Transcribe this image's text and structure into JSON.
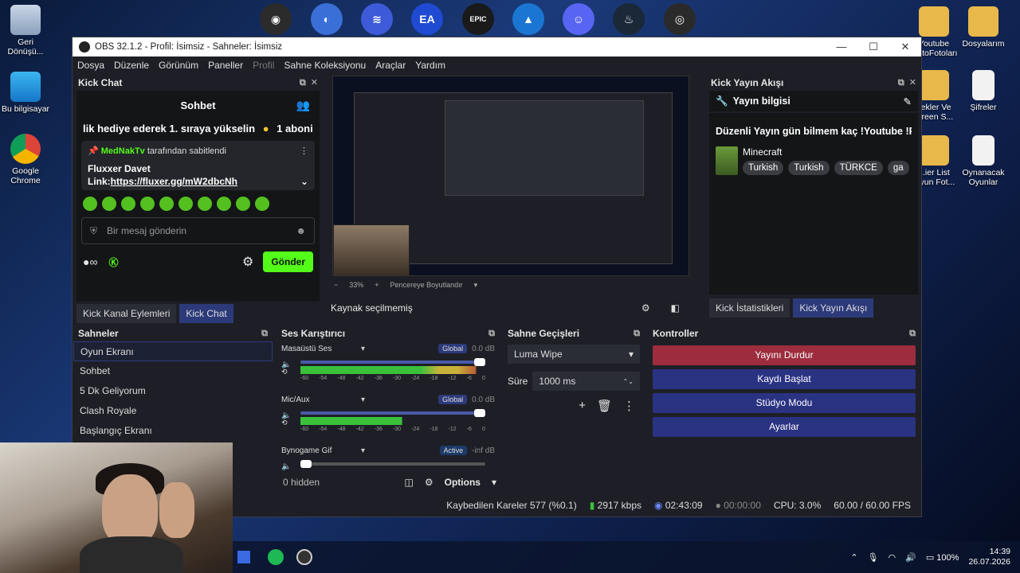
{
  "desktop": {
    "left_icons": [
      {
        "label": "Geri Dönüşü..."
      },
      {
        "label": "Bu bilgisayar"
      },
      {
        "label": "Google Chrome"
      }
    ],
    "right_icons": [
      {
        "label": "Youtube ...otoFotoları"
      },
      {
        "label": "Dosyalarım"
      },
      {
        "label": "Şifreler"
      },
      {
        "label": "Tekler Ve ...reen S..."
      },
      {
        "label": "...ier List ...yun Fot..."
      },
      {
        "label": "Oynanacak Oyunlar"
      }
    ],
    "top_icons": [
      {
        "name": "obs",
        "color": "#2b2b2b",
        "glyph": "◉"
      },
      {
        "name": "browser",
        "color": "#3b6fd8",
        "glyph": "◐"
      },
      {
        "name": "app-wave",
        "color": "#3d5bd9",
        "glyph": "≋"
      },
      {
        "name": "ea",
        "color": "#1f4ad1",
        "glyph": "EA"
      },
      {
        "name": "epic-games",
        "color": "#1a1a1a",
        "glyph": "EPIC"
      },
      {
        "name": "app-mountain",
        "color": "#1a76d2",
        "glyph": "▲"
      },
      {
        "name": "discord",
        "color": "#5865f2",
        "glyph": "☺"
      },
      {
        "name": "steam",
        "color": "#1b2838",
        "glyph": "♨"
      },
      {
        "name": "app-spiral",
        "color": "#2a2a2a",
        "glyph": "◎"
      }
    ]
  },
  "window": {
    "title": "OBS 32.1.2 - Profil: İsimsiz - Sahneler: İsimsiz",
    "controls": [
      "—",
      "☐",
      "✕"
    ]
  },
  "menu": [
    "Dosya",
    "Düzenle",
    "Görünüm",
    "Paneller",
    "Profil",
    "Sahne Koleksiyonu",
    "Araçlar",
    "Yardım"
  ],
  "chat": {
    "dock_title": "Kick Chat",
    "panel_title": "Sohbet",
    "message_line": "lik hediye ederek 1. sıraya yükselin",
    "message_count": "1 aboni",
    "pinned_user": "MedNakTv",
    "pinned_suffix": "tarafından sabitlendi",
    "pinned_line1": "Fluxxer Davet",
    "pinned_link_prefix": "Link:",
    "pinned_link": "https://fluxer.gg/mW2dbcNh",
    "input_placeholder": "Bir mesaj gönderin",
    "send_label": "Gönder",
    "tabs": [
      "Kick Kanal Eylemleri",
      "Kick Chat"
    ]
  },
  "preview": {
    "zoom": "33%",
    "fit_label": "Pencereye Boyutlandır",
    "source_status": "Kaynak seçilmemiş"
  },
  "stream_info": {
    "dock_title": "Kick Yayın Akışı",
    "header": "Yayın bilgisi",
    "title": "Düzenli Yayın gün bilmem kaç !Youtube !Pc",
    "category": "Minecraft",
    "tags": [
      "Turkish",
      "Turkish",
      "TÜRKCE",
      "ga"
    ],
    "tabs": [
      "Kick İstatistikleri",
      "Kick Yayın Akışı"
    ]
  },
  "scenes": {
    "title": "Sahneler",
    "items": [
      "Oyun Ekranı",
      "Sohbet",
      "5 Dk Geliyorum",
      "Clash Royale",
      "Başlangıç Ekranı"
    ]
  },
  "mixer": {
    "title": "Ses Karıştırıcı",
    "channels": [
      {
        "name": "Masaüstü Ses",
        "badge": "Global",
        "db": "0.0 dB",
        "level": 0.95
      },
      {
        "name": "Mic/Aux",
        "badge": "Global",
        "db": "0.0 dB",
        "level": 0.55
      },
      {
        "name": "Bynogame Gif",
        "badge": "Active",
        "db": "-inf dB",
        "level": 0.0
      }
    ],
    "scale": [
      "-60",
      "-54",
      "-48",
      "-42",
      "-36",
      "-30",
      "-24",
      "-18",
      "-12",
      "-6",
      "0"
    ],
    "hidden": "0 hidden",
    "options": "Options"
  },
  "transitions": {
    "title": "Sahne Geçişleri",
    "selected": "Luma Wipe",
    "duration_label": "Süre",
    "duration_value": "1000 ms"
  },
  "controls": {
    "title": "Kontroller",
    "buttons": [
      "Yayını Durdur",
      "Kaydı Başlat",
      "Stüdyo Modu",
      "Ayarlar"
    ]
  },
  "status": {
    "dropped": "Kaybedilen Kareler 577 (%0.1)",
    "bitrate": "2917 kbps",
    "stream_time": "02:43:09",
    "rec_time": "00:00:00",
    "cpu": "CPU: 3.0%",
    "fps": "60.00 / 60.00 FPS"
  },
  "taskbar": {
    "battery": "100%",
    "time": "14:39",
    "date": "26.07.2026"
  }
}
